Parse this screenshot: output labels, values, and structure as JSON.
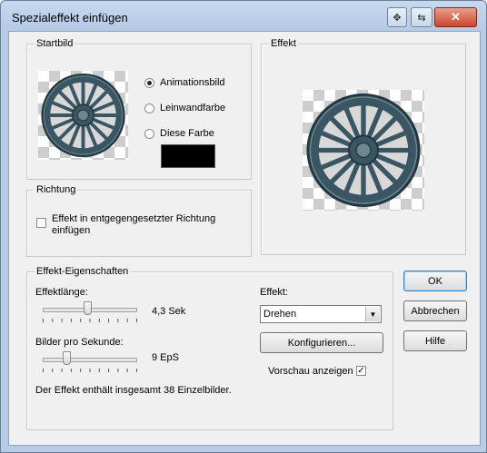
{
  "window": {
    "title": "Spezialeffekt einfügen"
  },
  "startbild": {
    "group_label": "Startbild",
    "options": [
      {
        "label": "Animationsbild",
        "selected": true
      },
      {
        "label": "Leinwandfarbe",
        "selected": false
      },
      {
        "label": "Diese Farbe",
        "selected": false
      }
    ],
    "color_swatch": "#000000"
  },
  "effekt_preview": {
    "group_label": "Effekt"
  },
  "richtung": {
    "group_label": "Richtung",
    "checkbox_label_line1": "Effekt in entgegengesetzter Richtung",
    "checkbox_label_line2": "einfügen",
    "checked": false
  },
  "eigenschaften": {
    "group_label": "Effekt-Eigenschaften",
    "length_label": "Effektlänge:",
    "length_value": "4,3 Sek",
    "length_fraction": 0.47,
    "fps_label": "Bilder pro Sekunde:",
    "fps_value": "9 EpS",
    "fps_fraction": 0.23,
    "summary": "Der Effekt enthält insgesamt 38 Einzelbilder.",
    "effect_label": "Effekt:",
    "effect_value": "Drehen",
    "configure_button": "Konfigurieren...",
    "preview_label": "Vorschau anzeigen",
    "preview_checked": true
  },
  "buttons": {
    "ok": "OK",
    "cancel": "Abbrechen",
    "help": "Hilfe"
  },
  "colors": {
    "wheel": "#3b5663",
    "wheel_dark": "#22363f",
    "wheel_light": "#6d8791"
  }
}
